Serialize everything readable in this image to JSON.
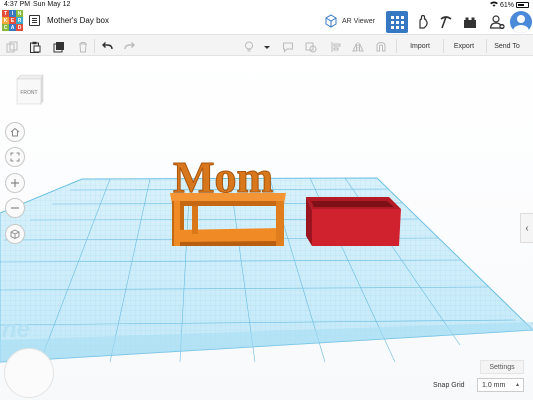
{
  "status_bar": {
    "time": "4:37 PM",
    "date": "Sun May 12",
    "battery": "61%"
  },
  "header": {
    "logo_letters": [
      "TIN",
      "KER",
      "CAD"
    ],
    "logo_colors": [
      "#e44d3a",
      "#3778c2",
      "#86b93c",
      "#f3a73b",
      "#e44d3a",
      "#37a8c9",
      "#86b93c",
      "#3778c2",
      "#e44d3a"
    ],
    "design_title": "Mother's Day box",
    "ar_viewer_label": "AR Viewer"
  },
  "toolbar": {
    "import_label": "Import",
    "export_label": "Export",
    "send_to_label": "Send To"
  },
  "workplane": {
    "view_cube_label": "FRONT",
    "text_shape": "Mom",
    "orange_color": "#f08a24",
    "red_color": "#d0212f",
    "grid_color": "#8fd3ee"
  },
  "bottom": {
    "settings_label": "Settings",
    "snap_grid_label": "Snap Grid",
    "snap_grid_value": "1.0 mm"
  }
}
